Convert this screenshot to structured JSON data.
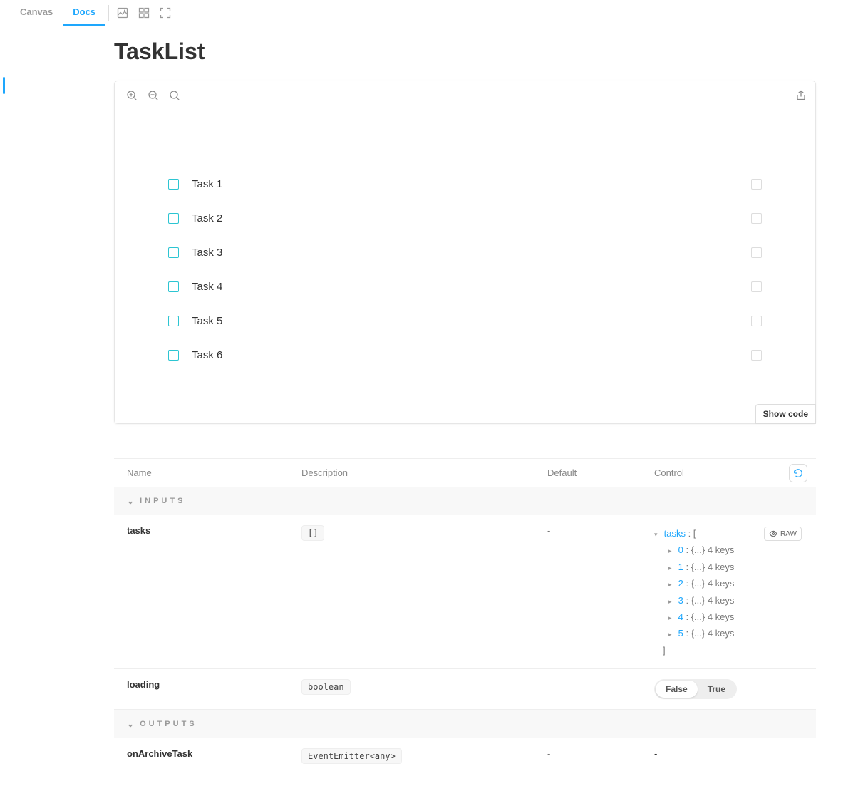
{
  "tabs": {
    "canvas": "Canvas",
    "docs": "Docs"
  },
  "page_title": "TaskList",
  "story": {
    "tasks": [
      "Task 1",
      "Task 2",
      "Task 3",
      "Task 4",
      "Task 5",
      "Task 6"
    ]
  },
  "show_code_label": "Show code",
  "args_table": {
    "headers": {
      "name": "Name",
      "description": "Description",
      "default": "Default",
      "control": "Control"
    },
    "sections": {
      "inputs": "INPUTS",
      "outputs": "OUTPUTS"
    },
    "rows": {
      "tasks": {
        "name": "tasks",
        "desc_code": "[]",
        "default": "-",
        "control": {
          "root_key": "tasks",
          "items": [
            {
              "idx": "0",
              "suffix": " : {...} 4 keys"
            },
            {
              "idx": "1",
              "suffix": " : {...} 4 keys"
            },
            {
              "idx": "2",
              "suffix": " : {...} 4 keys"
            },
            {
              "idx": "3",
              "suffix": " : {...} 4 keys"
            },
            {
              "idx": "4",
              "suffix": " : {...} 4 keys"
            },
            {
              "idx": "5",
              "suffix": " : {...} 4 keys"
            }
          ]
        }
      },
      "loading": {
        "name": "loading",
        "desc_code": "boolean",
        "default": "",
        "control": {
          "type": "boolean",
          "false": "False",
          "true": "True",
          "selected": "false"
        }
      },
      "onArchiveTask": {
        "name": "onArchiveTask",
        "desc_code": "EventEmitter<any>",
        "default": "-",
        "control": "-"
      }
    },
    "raw_label": "RAW"
  }
}
